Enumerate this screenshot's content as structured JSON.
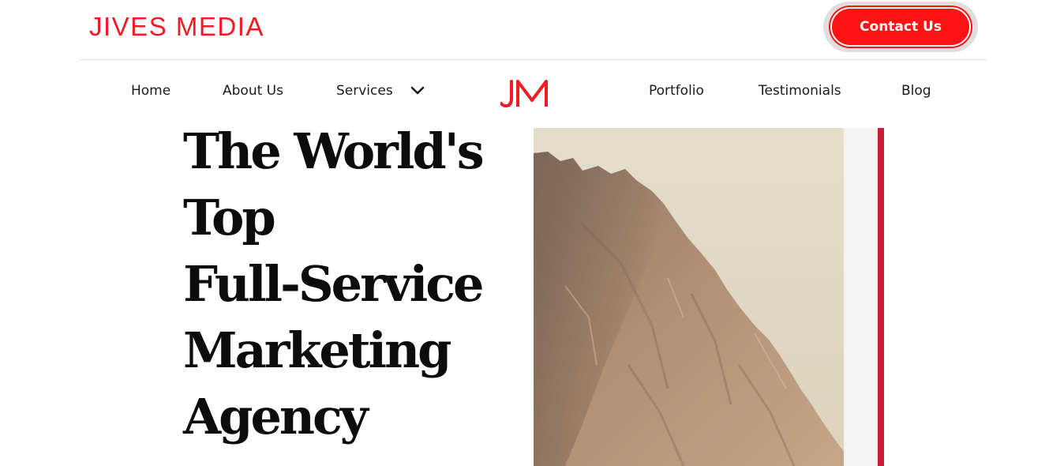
{
  "header": {
    "brand": "JIVES MEDIA",
    "contact_label": "Contact Us"
  },
  "nav": {
    "home": "Home",
    "about": "About Us",
    "services": "Services",
    "portfolio": "Portfolio",
    "testimonials": "Testimonials",
    "blog": "Blog",
    "logo_text": "JM"
  },
  "hero": {
    "headline_lines": [
      "The World's",
      "Top",
      "Full-Service",
      "Marketing",
      "Agency"
    ],
    "image": "mountain-cliff"
  },
  "colors": {
    "brand_red": "#ee1c25",
    "button_red": "#ff1212",
    "accent_bar": "#c8203a"
  }
}
